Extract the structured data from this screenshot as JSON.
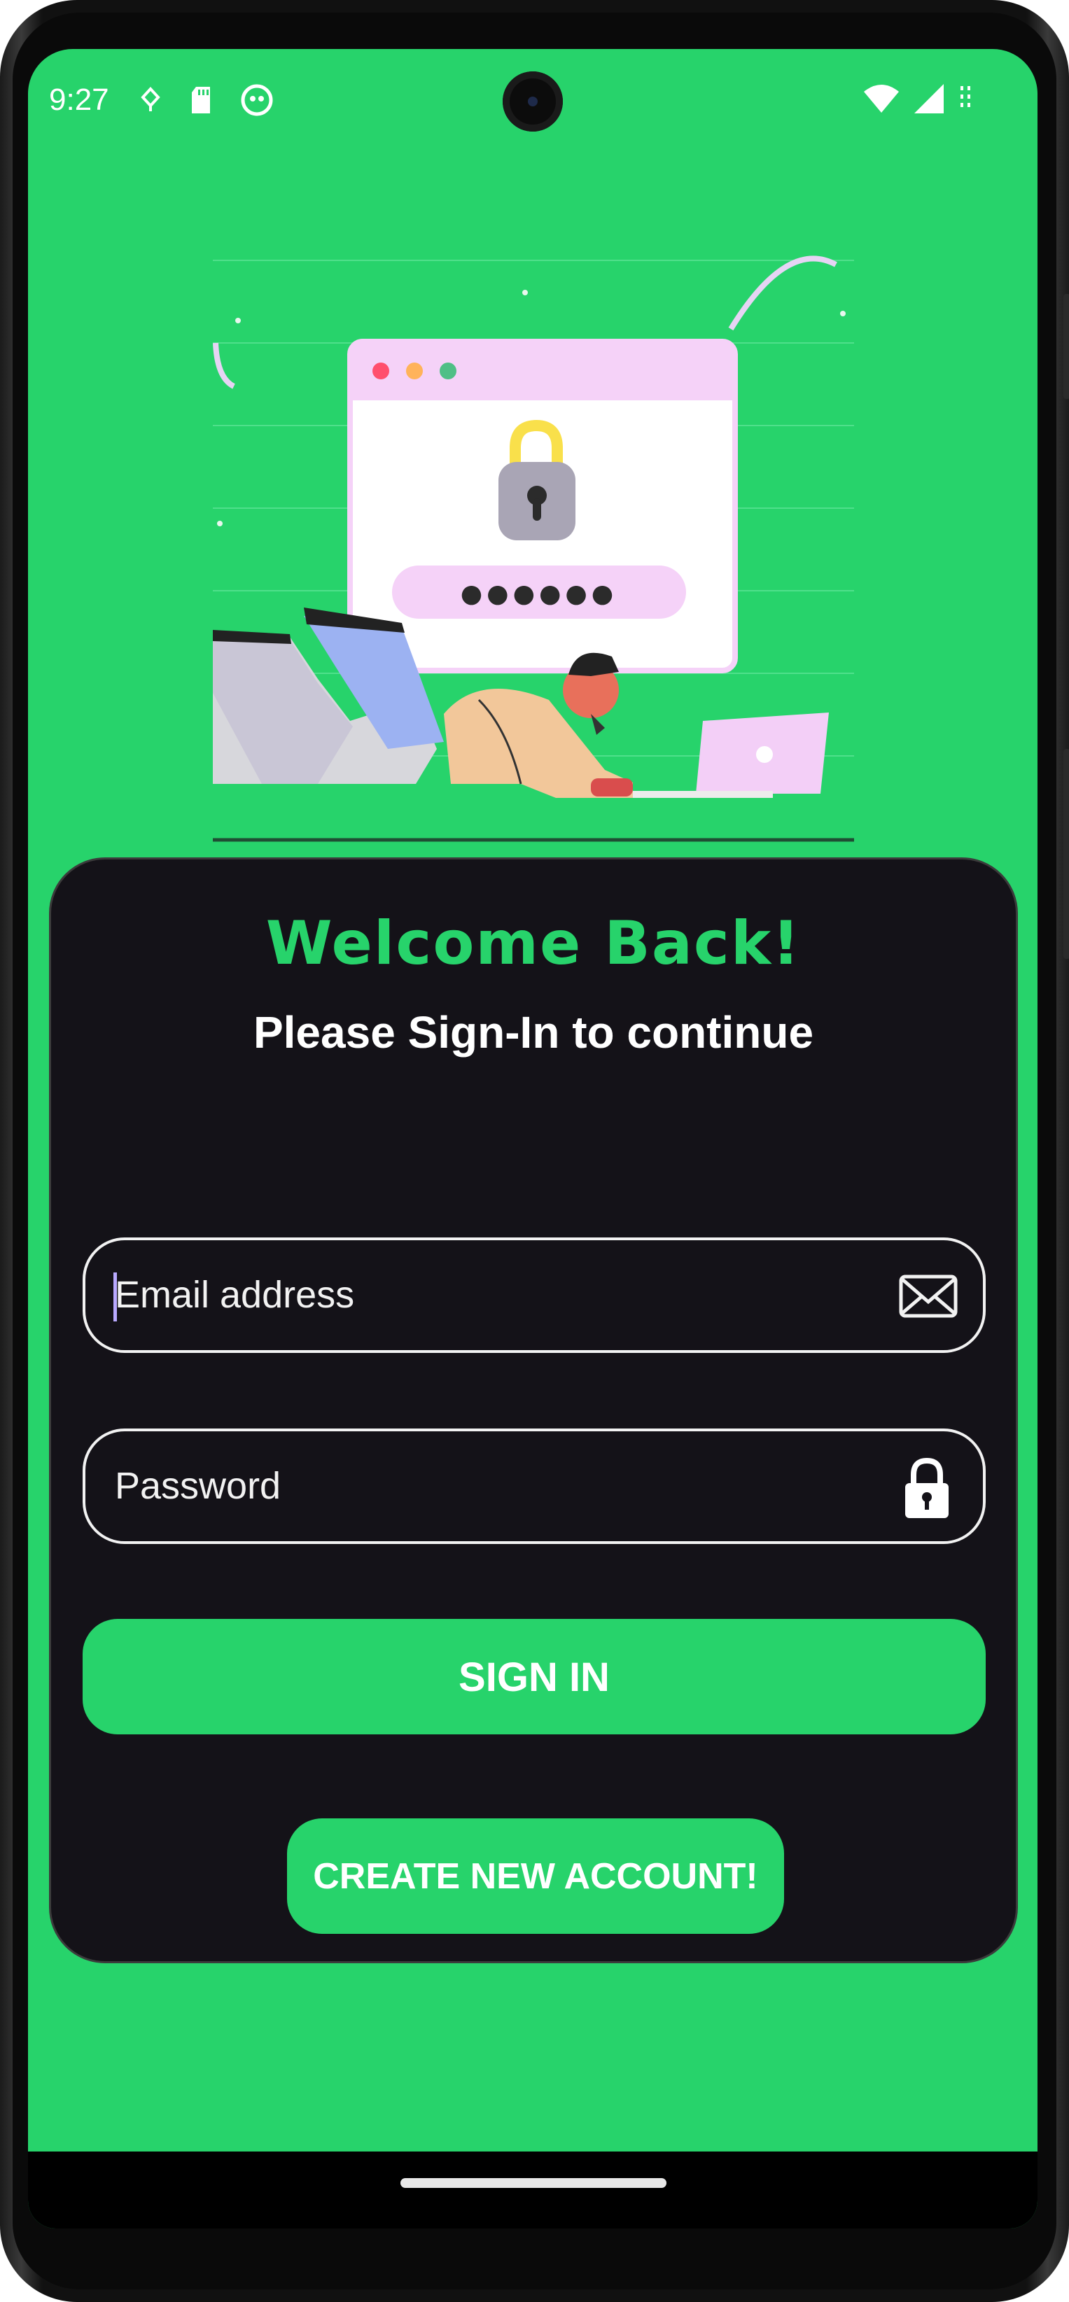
{
  "status_bar": {
    "time": "9:27",
    "left_icons": [
      "notification-icon",
      "sd-card-icon",
      "app-icon"
    ],
    "right_icons": [
      "wifi-icon",
      "signal-icon",
      "battery-icon"
    ]
  },
  "illustration": {
    "password_dots": "●●●●●●"
  },
  "login": {
    "title": "Welcome Back!",
    "subtitle": "Please Sign-In to continue",
    "email_placeholder": "Email address",
    "password_placeholder": "Password",
    "sign_in_label": "SIGN IN",
    "create_account_label": "CREATE NEW ACCOUNT!"
  },
  "colors": {
    "accent": "#27d36b",
    "card_background": "#141218",
    "text_primary": "#ffffff"
  }
}
